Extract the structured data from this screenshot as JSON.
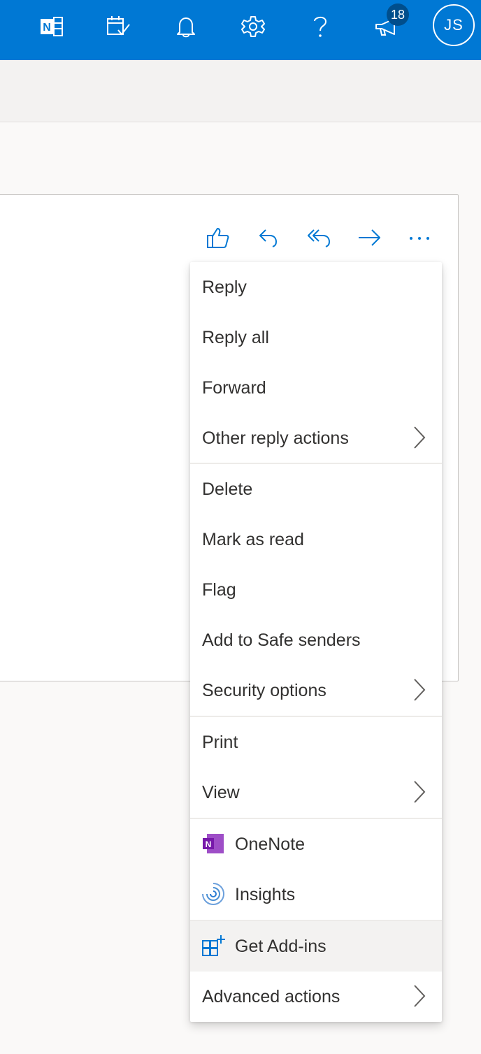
{
  "topbar": {
    "accent": "#0078d4",
    "icons": [
      "onenote-feed-icon",
      "my-day-icon",
      "bell-icon",
      "gear-icon",
      "help-icon",
      "megaphone-icon"
    ],
    "notification_count": "18",
    "avatar_initials": "JS"
  },
  "message_actions": {
    "icons": [
      "like-icon",
      "reply-icon",
      "reply-all-icon",
      "forward-icon",
      "more-actions-icon"
    ]
  },
  "menu": {
    "groups": [
      [
        {
          "label": "Reply",
          "submenu": false
        },
        {
          "label": "Reply all",
          "submenu": false
        },
        {
          "label": "Forward",
          "submenu": false
        },
        {
          "label": "Other reply actions",
          "submenu": true
        }
      ],
      [
        {
          "label": "Delete",
          "submenu": false
        },
        {
          "label": "Mark as read",
          "submenu": false
        },
        {
          "label": "Flag",
          "submenu": false
        },
        {
          "label": "Add to Safe senders",
          "submenu": false
        },
        {
          "label": "Security options",
          "submenu": true
        }
      ],
      [
        {
          "label": "Print",
          "submenu": false
        },
        {
          "label": "View",
          "submenu": true
        }
      ],
      [
        {
          "label": "OneNote",
          "icon": "onenote-icon",
          "submenu": false
        },
        {
          "label": "Insights",
          "icon": "insights-icon",
          "submenu": false
        }
      ],
      [
        {
          "label": "Get Add-ins",
          "icon": "get-addins-icon",
          "submenu": false,
          "highlighted": true
        },
        {
          "label": "Advanced actions",
          "submenu": true
        }
      ]
    ]
  }
}
